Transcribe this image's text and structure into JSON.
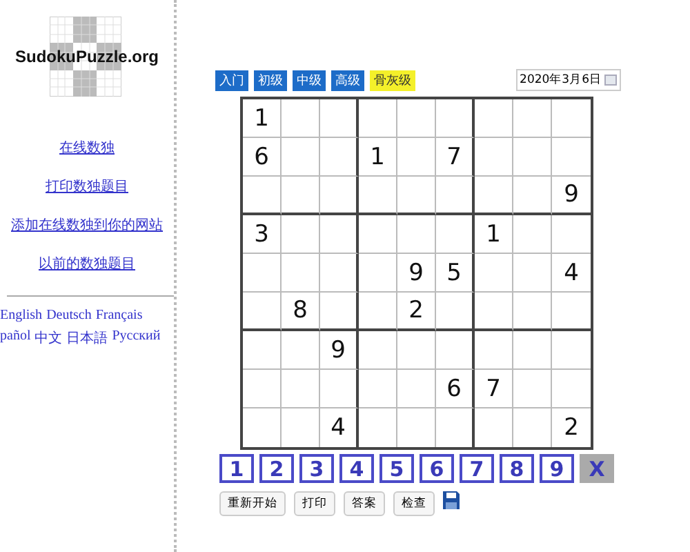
{
  "sidebar": {
    "logo": {
      "text": "SudokuPuzzle.org"
    },
    "links": [
      {
        "label": "在线数独"
      },
      {
        "label": "打印数独题目"
      },
      {
        "label": "添加在线数独到你的网站"
      },
      {
        "label": "以前的数独题目"
      }
    ],
    "languages": [
      [
        "English",
        "Deutsch",
        "Français"
      ],
      [
        "pañol",
        "中文",
        "日本語",
        "Русский"
      ]
    ]
  },
  "levels": [
    {
      "label": "入门",
      "selected": false
    },
    {
      "label": "初级",
      "selected": false
    },
    {
      "label": "中级",
      "selected": false
    },
    {
      "label": "高级",
      "selected": false
    },
    {
      "label": "骨灰级",
      "selected": true
    }
  ],
  "date_field": {
    "value": "2020年3月6日"
  },
  "grid": [
    [
      {
        "kind": "given",
        "value": "1"
      },
      {
        "kind": "blank"
      },
      {
        "kind": "blank"
      },
      {
        "kind": "blank"
      },
      {
        "kind": "blank"
      },
      {
        "kind": "blank"
      },
      {
        "kind": "blank"
      },
      {
        "kind": "blank"
      },
      {
        "kind": "blank"
      }
    ],
    [
      {
        "kind": "given",
        "value": "6"
      },
      {
        "kind": "blank"
      },
      {
        "kind": "blank"
      },
      {
        "kind": "given",
        "value": "1"
      },
      {
        "kind": "blank"
      },
      {
        "kind": "given",
        "value": "7"
      },
      {
        "kind": "blank"
      },
      {
        "kind": "blank"
      },
      {
        "kind": "blank"
      }
    ],
    [
      {
        "kind": "blank"
      },
      {
        "kind": "blank"
      },
      {
        "kind": "blank"
      },
      {
        "kind": "blank"
      },
      {
        "kind": "blank"
      },
      {
        "kind": "blank"
      },
      {
        "kind": "blank"
      },
      {
        "kind": "blank"
      },
      {
        "kind": "given",
        "value": "9"
      }
    ],
    [
      {
        "kind": "given",
        "value": "3"
      },
      {
        "kind": "blank"
      },
      {
        "kind": "blank"
      },
      {
        "kind": "blank"
      },
      {
        "kind": "blank"
      },
      {
        "kind": "blank"
      },
      {
        "kind": "given",
        "value": "1"
      },
      {
        "kind": "blank"
      },
      {
        "kind": "blank"
      }
    ],
    [
      {
        "kind": "blank"
      },
      {
        "kind": "blank"
      },
      {
        "kind": "blank"
      },
      {
        "kind": "blank"
      },
      {
        "kind": "given",
        "value": "9"
      },
      {
        "kind": "given",
        "value": "5"
      },
      {
        "kind": "blank"
      },
      {
        "kind": "blank"
      },
      {
        "kind": "given",
        "value": "4"
      }
    ],
    [
      {
        "kind": "blank"
      },
      {
        "kind": "given",
        "value": "8"
      },
      {
        "kind": "blank"
      },
      {
        "kind": "blank"
      },
      {
        "kind": "given",
        "value": "2"
      },
      {
        "kind": "blank"
      },
      {
        "kind": "blank"
      },
      {
        "kind": "blank"
      },
      {
        "kind": "blank"
      }
    ],
    [
      {
        "kind": "blank"
      },
      {
        "kind": "blank"
      },
      {
        "kind": "given",
        "value": "9"
      },
      {
        "kind": "blank"
      },
      {
        "kind": "blank"
      },
      {
        "kind": "blank"
      },
      {
        "kind": "blank"
      },
      {
        "kind": "blank"
      },
      {
        "kind": "blank"
      }
    ],
    [
      {
        "kind": "blank"
      },
      {
        "kind": "blank"
      },
      {
        "kind": "blank"
      },
      {
        "kind": "blank"
      },
      {
        "kind": "blank"
      },
      {
        "kind": "given",
        "value": "6"
      },
      {
        "kind": "given",
        "value": "7"
      },
      {
        "kind": "blank"
      },
      {
        "kind": "blank"
      }
    ],
    [
      {
        "kind": "blank"
      },
      {
        "kind": "blank"
      },
      {
        "kind": "given",
        "value": "4"
      },
      {
        "kind": "blank"
      },
      {
        "kind": "blank"
      },
      {
        "kind": "blank"
      },
      {
        "kind": "blank"
      },
      {
        "kind": "blank"
      },
      {
        "kind": "given",
        "value": "2"
      }
    ]
  ],
  "number_pad": [
    {
      "label": "1",
      "kind": "digit"
    },
    {
      "label": "2",
      "kind": "digit"
    },
    {
      "label": "3",
      "kind": "digit"
    },
    {
      "label": "4",
      "kind": "digit"
    },
    {
      "label": "5",
      "kind": "digit"
    },
    {
      "label": "6",
      "kind": "digit"
    },
    {
      "label": "7",
      "kind": "digit"
    },
    {
      "label": "8",
      "kind": "digit"
    },
    {
      "label": "9",
      "kind": "digit"
    },
    {
      "label": "X",
      "kind": "clear"
    }
  ],
  "buttons": [
    "重新开始",
    "打印",
    "答案",
    "检查"
  ]
}
